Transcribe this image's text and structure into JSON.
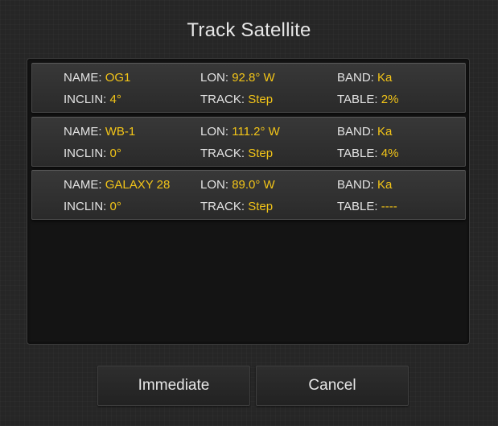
{
  "dialog": {
    "title": "Track Satellite"
  },
  "satellites": [
    {
      "name_label": "NAME:",
      "name": "OG1",
      "lon_label": "LON:",
      "lon": "92.8° W",
      "band_label": "BAND:",
      "band": "Ka",
      "inclin_label": "INCLIN:",
      "inclin": "4°",
      "track_label": "TRACK:",
      "track": "Step",
      "table_label": "TABLE:",
      "table": "2%"
    },
    {
      "name_label": "NAME:",
      "name": "WB-1",
      "lon_label": "LON:",
      "lon": "111.2° W",
      "band_label": "BAND:",
      "band": "Ka",
      "inclin_label": "INCLIN:",
      "inclin": "0°",
      "track_label": "TRACK:",
      "track": "Step",
      "table_label": "TABLE:",
      "table": "4%"
    },
    {
      "name_label": "NAME:",
      "name": "GALAXY 28",
      "lon_label": "LON:",
      "lon": "89.0° W",
      "band_label": "BAND:",
      "band": "Ka",
      "inclin_label": "INCLIN:",
      "inclin": "0°",
      "track_label": "TRACK:",
      "track": "Step",
      "table_label": "TABLE:",
      "table": "----"
    }
  ],
  "buttons": {
    "immediate_label": "Immediate",
    "cancel_label": "Cancel"
  },
  "colors": {
    "value": "#f2c418",
    "label": "#e4e4e4",
    "background": "#262626"
  }
}
